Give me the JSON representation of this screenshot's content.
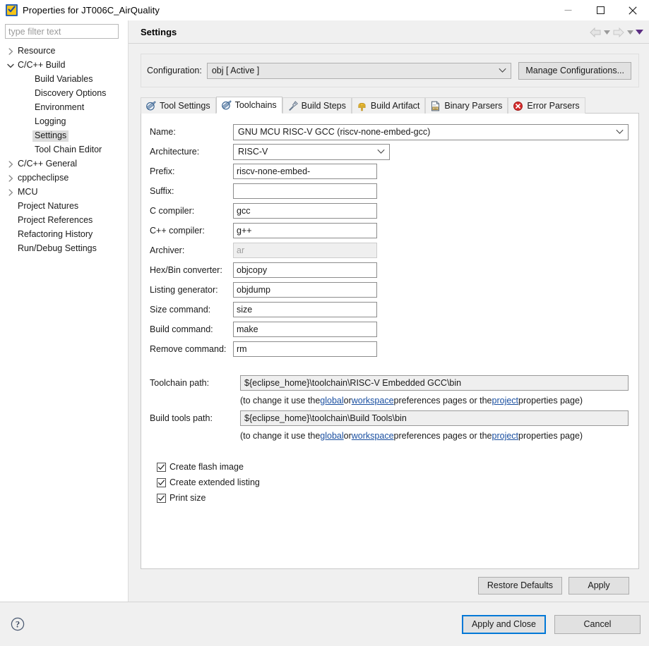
{
  "window": {
    "title": "Properties for JT006C_AirQuality",
    "icon": "eclipse-checkmark-icon",
    "minimize_label": "Minimize",
    "maximize_label": "Maximize",
    "close_label": "Close"
  },
  "sidebar": {
    "filter_placeholder": "type filter text",
    "filter_value": "",
    "items": [
      {
        "label": "Resource",
        "indent": 0,
        "arrow": "collapsed",
        "selected": false
      },
      {
        "label": "C/C++ Build",
        "indent": 0,
        "arrow": "expanded",
        "selected": false
      },
      {
        "label": "Build Variables",
        "indent": 1,
        "arrow": "none",
        "selected": false
      },
      {
        "label": "Discovery Options",
        "indent": 1,
        "arrow": "none",
        "selected": false
      },
      {
        "label": "Environment",
        "indent": 1,
        "arrow": "none",
        "selected": false
      },
      {
        "label": "Logging",
        "indent": 1,
        "arrow": "none",
        "selected": false
      },
      {
        "label": "Settings",
        "indent": 1,
        "arrow": "none",
        "selected": true
      },
      {
        "label": "Tool Chain Editor",
        "indent": 1,
        "arrow": "none",
        "selected": false
      },
      {
        "label": "C/C++ General",
        "indent": 0,
        "arrow": "collapsed",
        "selected": false
      },
      {
        "label": "cppcheclipse",
        "indent": 0,
        "arrow": "collapsed",
        "selected": false
      },
      {
        "label": "MCU",
        "indent": 0,
        "arrow": "collapsed",
        "selected": false
      },
      {
        "label": "Project Natures",
        "indent": 0,
        "arrow": "none",
        "selected": false
      },
      {
        "label": "Project References",
        "indent": 0,
        "arrow": "none",
        "selected": false
      },
      {
        "label": "Refactoring History",
        "indent": 0,
        "arrow": "none",
        "selected": false
      },
      {
        "label": "Run/Debug Settings",
        "indent": 0,
        "arrow": "none",
        "selected": false
      }
    ]
  },
  "page": {
    "title": "Settings",
    "nav": {
      "back_label": "Back",
      "back_menu_label": "Back history",
      "forward_label": "Forward",
      "forward_menu_label": "Forward history",
      "view_menu_label": "View menu"
    }
  },
  "configuration": {
    "label": "Configuration:",
    "value": "obj  [ Active ]",
    "manage_button": "Manage Configurations..."
  },
  "tabs": [
    {
      "label": "Tool Settings",
      "icon": "toolchain-icon",
      "active": false
    },
    {
      "label": "Toolchains",
      "icon": "toolchain-icon",
      "active": true
    },
    {
      "label": "Build Steps",
      "icon": "build-steps-icon",
      "active": false
    },
    {
      "label": "Build Artifact",
      "icon": "artifact-icon",
      "active": false
    },
    {
      "label": "Binary Parsers",
      "icon": "binary-parser-icon",
      "active": false
    },
    {
      "label": "Error Parsers",
      "icon": "error-parser-icon",
      "active": false
    }
  ],
  "form": {
    "name": {
      "label": "Name:",
      "value": "GNU MCU RISC-V GCC (riscv-none-embed-gcc)",
      "type": "combo"
    },
    "architecture": {
      "label": "Architecture:",
      "value": "RISC-V",
      "type": "combo"
    },
    "prefix": {
      "label": "Prefix:",
      "value": "riscv-none-embed-",
      "type": "text"
    },
    "suffix": {
      "label": "Suffix:",
      "value": "",
      "type": "text"
    },
    "c_compiler": {
      "label": "C compiler:",
      "value": "gcc",
      "type": "text"
    },
    "cpp_compiler": {
      "label": "C++ compiler:",
      "value": "g++",
      "type": "text"
    },
    "archiver": {
      "label": "Archiver:",
      "value": "ar",
      "type": "text",
      "disabled": true
    },
    "hexbin": {
      "label": "Hex/Bin converter:",
      "value": "objcopy",
      "type": "text"
    },
    "listing": {
      "label": "Listing generator:",
      "value": "objdump",
      "type": "text"
    },
    "size": {
      "label": "Size command:",
      "value": "size",
      "type": "text"
    },
    "build": {
      "label": "Build command:",
      "value": "make",
      "type": "text"
    },
    "remove": {
      "label": "Remove command:",
      "value": "rm",
      "type": "text"
    }
  },
  "paths": {
    "toolchain": {
      "label": "Toolchain path:",
      "value": "${eclipse_home}\\toolchain\\RISC-V Embedded GCC\\bin"
    },
    "buildtools": {
      "label": "Build tools path:",
      "value": "${eclipse_home}\\toolchain\\Build Tools\\bin"
    },
    "hint": {
      "prefix": "(to change it use the ",
      "link_global": "global",
      "mid1": " or ",
      "link_workspace": "workspace",
      "mid2": " preferences pages or the ",
      "link_project": "project",
      "suffix": " properties page)"
    }
  },
  "checkboxes": [
    {
      "label": "Create flash image",
      "checked": true
    },
    {
      "label": "Create extended listing",
      "checked": true
    },
    {
      "label": "Print size",
      "checked": true
    }
  ],
  "panel_buttons": {
    "restore_defaults": "Restore Defaults",
    "apply": "Apply"
  },
  "dialog_buttons": {
    "help_label": "Help",
    "apply_and_close": "Apply and Close",
    "cancel": "Cancel"
  },
  "colors": {
    "accent": "#0078d7",
    "link": "#1a4fa0",
    "selection": "#dcdcdc",
    "panel": "#f0f0f0",
    "field_border": "#8c8c8c"
  }
}
